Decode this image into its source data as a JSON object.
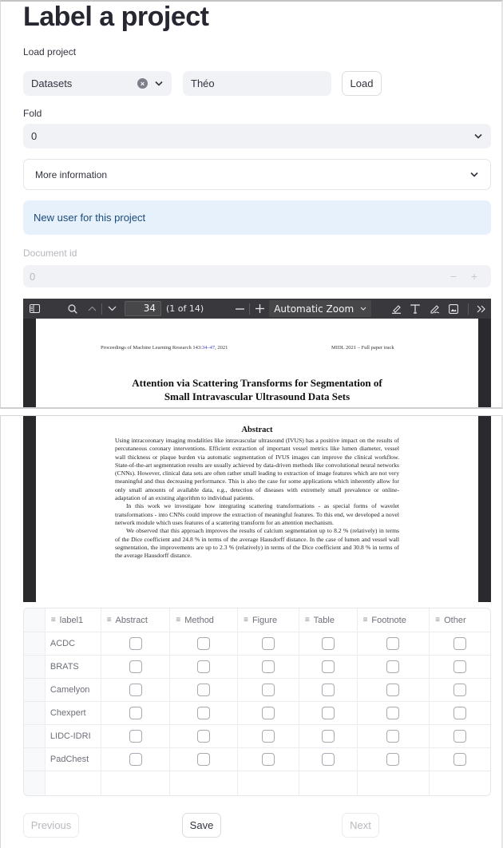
{
  "page": {
    "title": "Label a project",
    "load_project_label": "Load project",
    "dataset_select": {
      "value": "Datasets"
    },
    "user_input": {
      "value": "Théo"
    },
    "load_button": "Load",
    "fold_label": "Fold",
    "fold_select": {
      "value": "0"
    },
    "expander_label": "More information",
    "info_message": "New user for this project",
    "document_id_label": "Document id",
    "document_id_value": "0",
    "document_id_minus": "−",
    "document_id_plus": "+"
  },
  "pdf_viewer": {
    "toolbar": {
      "page_number": "34",
      "page_count": "(1 of 14)",
      "zoom_value": "Automatic Zoom",
      "icons": [
        "sidebar-toggle-icon",
        "find-icon",
        "previous-page-icon",
        "next-page-icon",
        "zoom-out-icon",
        "zoom-in-icon",
        "highlight-icon",
        "text-icon",
        "draw-icon",
        "image-icon",
        "tools-icon"
      ]
    },
    "document": {
      "header_left_pre": "Proceedings of Machine Learning Research 143:",
      "header_left_link": "34–47",
      "header_left_post": ", 2021",
      "header_right": "MIDL 2021 – Full paper track",
      "title_line1": "Attention via Scattering Transforms for Segmentation of",
      "title_line2": "Small Intravascular Ultrasound Data Sets",
      "abstract_heading": "Abstract",
      "abstract_paragraphs": [
        "Using intracoronary imaging modalities like intravascular ultrasound (IVUS) has a positive impact on the results of percutaneous coronary interventions. Efficient extraction of important vessel metrics like lumen diameter, vessel wall thickness or plaque burden via automatic segmentation of IVUS images can improve the clinical workflow. State-of-the-art segmentation results are usually achieved by data-driven methods like convolutional neural networks (CNNs). However, clinical data sets are often rather small leading to extraction of image features which are not very meaningful and thus decreasing performance. This is also the case for some applications which inherently allow for only small amounts of available data, e.g., detection of diseases with extremely small prevalence or online-adaptation of an existing algorithm to individual patients.",
        "In this work we investigate how integrating scattering transformations - as special forms of wavelet transformations - into CNNs could improve the extraction of meaningful features. To this end, we developed a novel network module which uses features of a scattering transform for an attention mechanism.",
        "We observed that this approach improves the results of calcium segmentation up to 8.2 % (relatively) in terms of the Dice coefficient and 24.8 % in terms of the average Hausdorff distance. In the case of lumen and vessel wall segmentation, the improvements are up to 2.3 % (relatively) in terms of the Dice coefficient and 30.8 % in terms of the average Hausdorff distance."
      ]
    }
  },
  "label_grid": {
    "columns": [
      "label1",
      "Abstract",
      "Method",
      "Figure",
      "Table",
      "Footnote",
      "Other"
    ],
    "rows": [
      {
        "label": "ACDC",
        "checks": [
          false,
          false,
          false,
          false,
          false,
          false
        ]
      },
      {
        "label": "BRATS",
        "checks": [
          false,
          false,
          false,
          false,
          false,
          false
        ]
      },
      {
        "label": "Camelyon",
        "checks": [
          false,
          false,
          false,
          false,
          false,
          false
        ]
      },
      {
        "label": "Chexpert",
        "checks": [
          false,
          false,
          false,
          false,
          false,
          false
        ]
      },
      {
        "label": "LIDC-IDRI",
        "checks": [
          false,
          false,
          false,
          false,
          false,
          false
        ]
      },
      {
        "label": "PadChest",
        "checks": [
          false,
          false,
          false,
          false,
          false,
          false
        ]
      }
    ]
  },
  "navigation": {
    "previous": "Previous",
    "save": "Save",
    "next": "Next"
  },
  "colors": {
    "info_bg": "#e7f1fc",
    "info_text": "#1b4a7a",
    "input_bg": "#f0f2f6",
    "pdf_toolbar": "#38383d"
  }
}
